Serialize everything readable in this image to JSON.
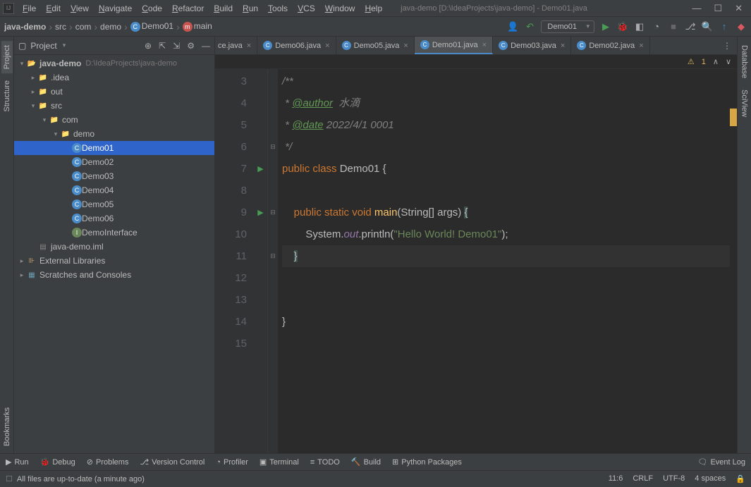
{
  "titlebar": {
    "menus": [
      "File",
      "Edit",
      "View",
      "Navigate",
      "Code",
      "Refactor",
      "Build",
      "Run",
      "Tools",
      "VCS",
      "Window",
      "Help"
    ],
    "title": "java-demo [D:\\IdeaProjects\\java-demo] - Demo01.java"
  },
  "breadcrumb": {
    "project": "java-demo",
    "sep": "›",
    "items": [
      "src",
      "com",
      "demo",
      "Demo01",
      "main"
    ]
  },
  "run_config": "Demo01",
  "sidebar": {
    "title": "Project",
    "root": {
      "name": "java-demo",
      "path": "D:\\IdeaProjects\\java-demo"
    },
    "idea": ".idea",
    "out": "out",
    "src": "src",
    "com": "com",
    "demo": "demo",
    "classes": [
      "Demo01",
      "Demo02",
      "Demo03",
      "Demo04",
      "Demo05",
      "Demo06"
    ],
    "interface": "DemoInterface",
    "iml": "java-demo.iml",
    "ext": "External Libraries",
    "scratch": "Scratches and Consoles"
  },
  "tabs": {
    "trunc": "ce.java",
    "items": [
      "Demo06.java",
      "Demo05.java",
      "Demo01.java",
      "Demo03.java",
      "Demo02.java"
    ],
    "activeIndex": 2
  },
  "warnings": {
    "count": "1"
  },
  "code": {
    "line_start": 3,
    "lines": [
      {
        "n": 3,
        "fold": "",
        "t": [
          {
            "c": "cmt",
            "v": "/**"
          }
        ]
      },
      {
        "n": 4,
        "fold": "",
        "t": [
          {
            "c": "cmt",
            "v": " * "
          },
          {
            "c": "tag",
            "v": "@author"
          },
          {
            "c": "cmt",
            "v": "  水滴"
          }
        ]
      },
      {
        "n": 5,
        "fold": "",
        "t": [
          {
            "c": "cmt",
            "v": " * "
          },
          {
            "c": "tag",
            "v": "@date"
          },
          {
            "c": "cmt",
            "v": " 2022/4/1 0001"
          }
        ]
      },
      {
        "n": 6,
        "fold": "⊟",
        "t": [
          {
            "c": "cmt",
            "v": " */"
          }
        ]
      },
      {
        "n": 7,
        "fold": "",
        "play": true,
        "t": [
          {
            "c": "kw",
            "v": "public class "
          },
          {
            "c": "cls",
            "v": "Demo01 {"
          }
        ]
      },
      {
        "n": 8,
        "fold": "",
        "t": []
      },
      {
        "n": 9,
        "fold": "⊟",
        "play": true,
        "t": [
          {
            "c": "",
            "v": "    "
          },
          {
            "c": "kw",
            "v": "public static void "
          },
          {
            "c": "fn",
            "v": "main"
          },
          {
            "c": "cls",
            "v": "(String[] args) "
          },
          {
            "c": "brace-hl",
            "v": "{"
          }
        ]
      },
      {
        "n": 10,
        "fold": "",
        "t": [
          {
            "c": "",
            "v": "        System."
          },
          {
            "c": "static-it",
            "v": "out"
          },
          {
            "c": "",
            "v": ".println("
          },
          {
            "c": "str",
            "v": "\"Hello World! Demo01\""
          },
          {
            "c": "",
            "v": ");"
          }
        ]
      },
      {
        "n": 11,
        "fold": "⊟",
        "cursor": true,
        "t": [
          {
            "c": "",
            "v": "    "
          },
          {
            "c": "brace-hl",
            "v": "}"
          }
        ]
      },
      {
        "n": 12,
        "fold": "",
        "t": []
      },
      {
        "n": 13,
        "fold": "",
        "t": []
      },
      {
        "n": 14,
        "fold": "",
        "t": [
          {
            "c": "cls",
            "v": "}"
          }
        ]
      },
      {
        "n": 15,
        "fold": "",
        "t": []
      }
    ]
  },
  "bottom": {
    "buttons": [
      "Run",
      "Debug",
      "Problems",
      "Version Control",
      "Profiler",
      "Terminal",
      "TODO",
      "Build",
      "Python Packages"
    ],
    "event": "Event Log"
  },
  "status": {
    "msg": "All files are up-to-date (a minute ago)",
    "pos": "11:6",
    "crlf": "CRLF",
    "enc": "UTF-8",
    "indent": "4 spaces"
  },
  "right_stripe": [
    "Database",
    "SciView"
  ],
  "left_stripe": [
    "Project",
    "Structure",
    "Bookmarks"
  ]
}
